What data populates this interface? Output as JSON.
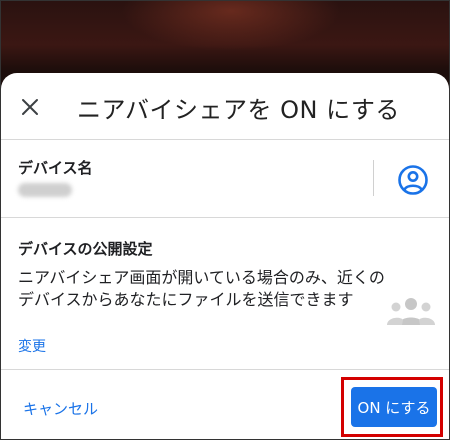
{
  "dialog": {
    "title": "ニアバイシェアを ON にする",
    "device_name_label": "デバイス名",
    "visibility_label": "デバイスの公開設定",
    "visibility_description": "ニアバイシェア画面が開いている場合のみ、近くのデバイスからあなたにファイルを送信できます",
    "change_link": "変更",
    "cancel_button": "キャンセル",
    "confirm_button": "ON にする"
  },
  "icons": {
    "close": "close-icon",
    "account": "account-circle-icon",
    "visibility": "people-group-icon"
  },
  "colors": {
    "accent": "#1a73e8",
    "highlight": "#d30000",
    "text": "#202124"
  }
}
